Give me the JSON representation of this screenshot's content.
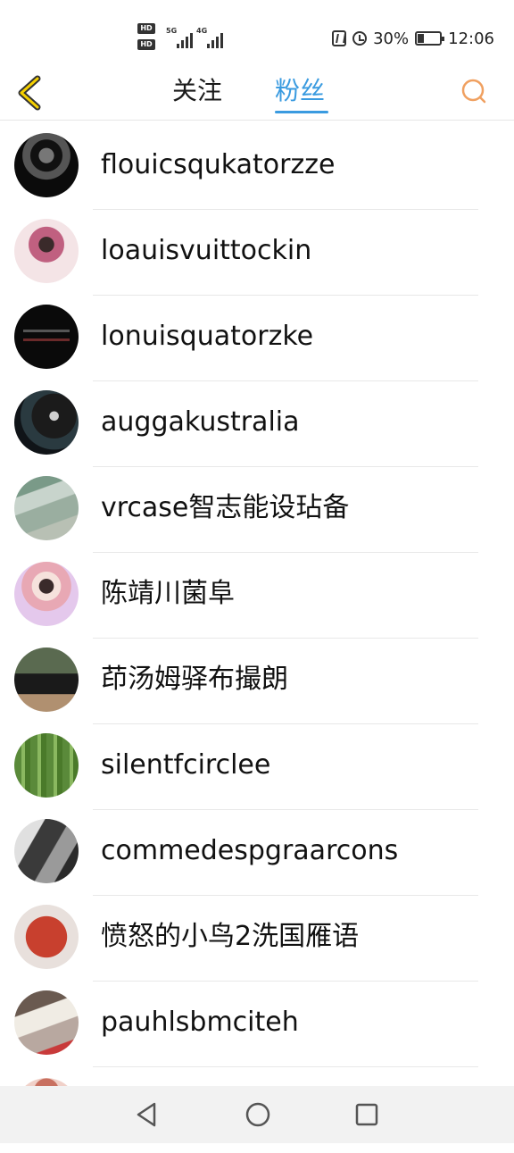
{
  "status_bar": {
    "hd_badge_1": "HD",
    "hd_badge_2": "HD",
    "network_1": "5G",
    "network_2": "4G",
    "battery_percent": "30%",
    "battery_level": 0.3,
    "time": "12:06",
    "icons": [
      "nfc-icon",
      "alarm-icon",
      "battery-icon",
      "signal-icon"
    ]
  },
  "header": {
    "tabs": [
      {
        "label": "关注",
        "active": false
      },
      {
        "label": "粉丝",
        "active": true
      }
    ],
    "accent_color": "#3a9be0",
    "back_icon": "chevron-left-icon",
    "search_icon": "search-icon"
  },
  "followers": [
    {
      "name": "flouicsqukatorzze"
    },
    {
      "name": "loauisvuittockin"
    },
    {
      "name": "lonuisquatorzke"
    },
    {
      "name": "auggakustralia"
    },
    {
      "name": "vrcase智志能设玷备"
    },
    {
      "name": "陈靖川菌阜"
    },
    {
      "name": "茚汤姆驿布撮朗"
    },
    {
      "name": "silentfcirclee"
    },
    {
      "name": "commedespgraarcons"
    },
    {
      "name": "愤怒的小鸟2洗国雁语"
    },
    {
      "name": "pauhlsbmciteh"
    }
  ],
  "nav_bar": {
    "icons": [
      "back-triangle-icon",
      "home-circle-icon",
      "recents-square-icon"
    ]
  }
}
